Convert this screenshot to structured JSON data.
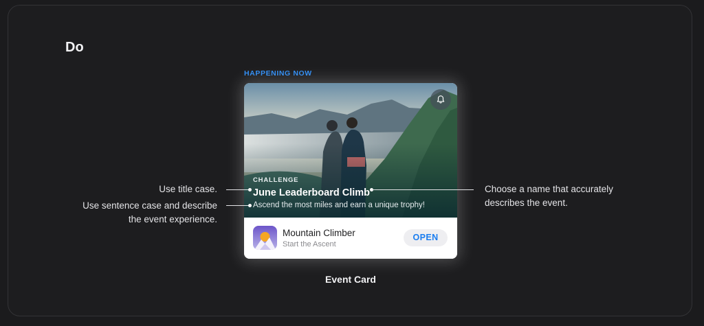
{
  "section": {
    "heading": "Do",
    "caption": "Event Card"
  },
  "card": {
    "eyebrow": "HAPPENING NOW",
    "event_kind": "CHALLENGE",
    "event_title": "June Leaderboard Climb",
    "event_description": "Ascend the most miles and earn a unique trophy!",
    "app_name": "Mountain Climber",
    "app_subtitle": "Start the Ascent",
    "open_label": "OPEN",
    "accent_color": "#2f8cf2",
    "icons": [
      "bell-icon",
      "app-icon"
    ]
  },
  "annotations": {
    "title_case": "Use title case.",
    "sentence_case_line1": "Use sentence case and describe",
    "sentence_case_line2": "the event experience.",
    "name_line1": "Choose a name that accurately",
    "name_line2": "describes the event."
  }
}
